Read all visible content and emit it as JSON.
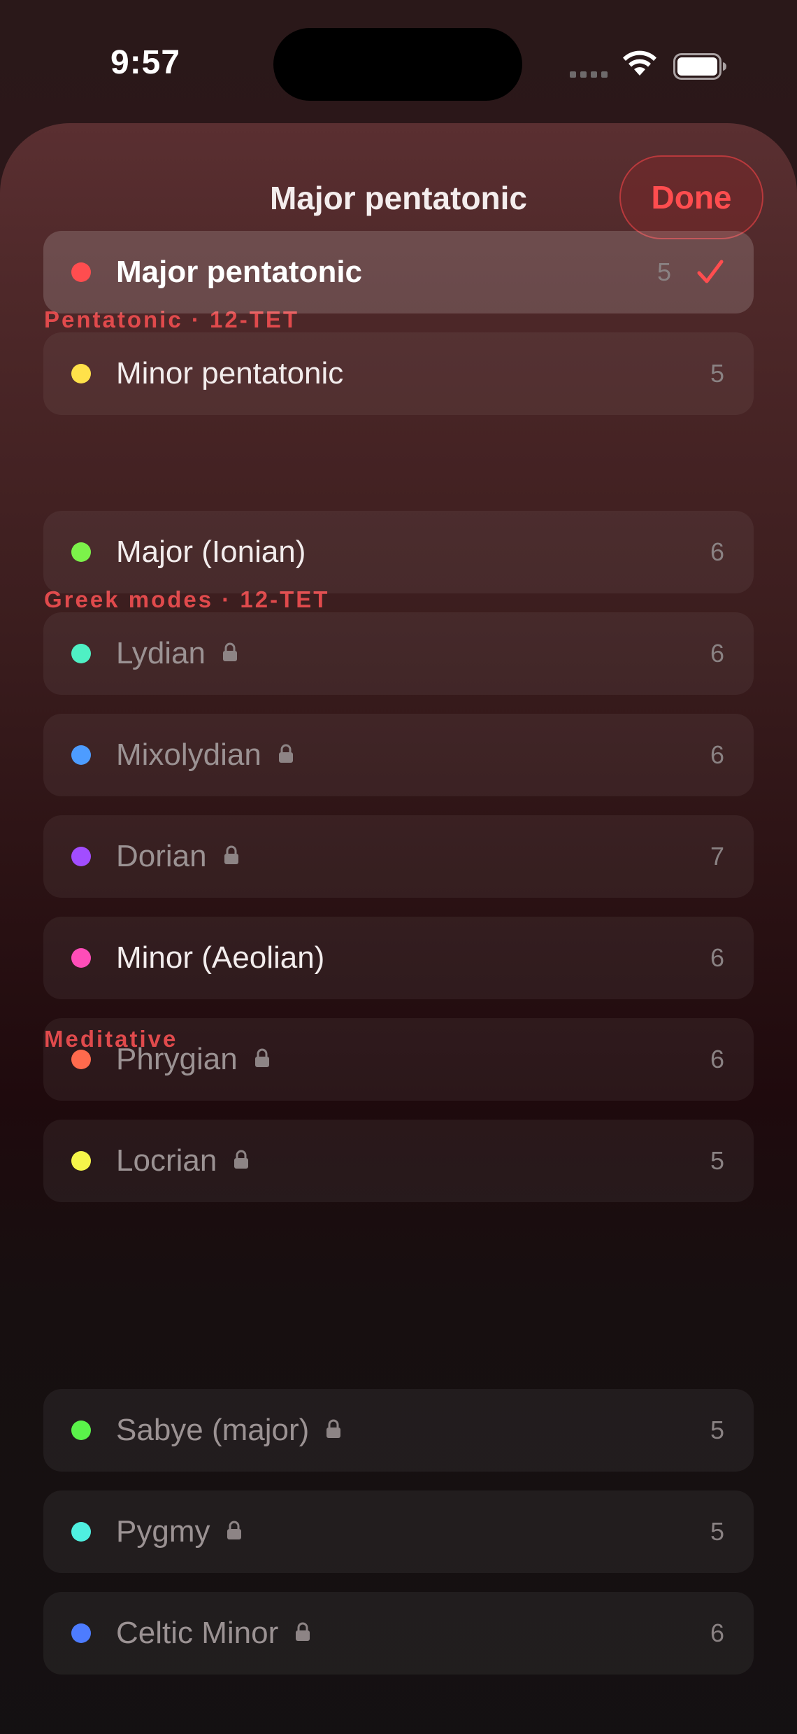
{
  "status_bar": {
    "time": "9:57"
  },
  "sheet": {
    "title": "Major pentatonic",
    "done_label": "Done"
  },
  "sections": [
    {
      "header": "Pentatonic · 12-TET",
      "items": [
        {
          "label": "Major pentatonic",
          "count": "5",
          "color": "#ff4d4f",
          "locked": false,
          "selected": true
        },
        {
          "label": "Minor pentatonic",
          "count": "5",
          "color": "#ffe14a",
          "locked": false,
          "selected": false
        }
      ]
    },
    {
      "header": "Greek modes · 12-TET",
      "items": [
        {
          "label": "Major (Ionian)",
          "count": "6",
          "color": "#7cf24a",
          "locked": false,
          "selected": false
        },
        {
          "label": "Lydian",
          "count": "6",
          "color": "#4ff0c4",
          "locked": true,
          "selected": false
        },
        {
          "label": "Mixolydian",
          "count": "6",
          "color": "#4d9cff",
          "locked": true,
          "selected": false
        },
        {
          "label": "Dorian",
          "count": "7",
          "color": "#a24dff",
          "locked": true,
          "selected": false
        },
        {
          "label": "Minor (Aeolian)",
          "count": "6",
          "color": "#ff4db8",
          "locked": false,
          "selected": false
        },
        {
          "label": "Phrygian",
          "count": "6",
          "color": "#ff6a4d",
          "locked": true,
          "selected": false
        },
        {
          "label": "Locrian",
          "count": "5",
          "color": "#f5f54a",
          "locked": true,
          "selected": false
        }
      ]
    },
    {
      "header": "Meditative",
      "items": [
        {
          "label": "Sabye (major)",
          "count": "5",
          "color": "#5af24a",
          "locked": true,
          "selected": false
        },
        {
          "label": "Pygmy",
          "count": "5",
          "color": "#4ff0e0",
          "locked": true,
          "selected": false
        },
        {
          "label": "Celtic Minor",
          "count": "6",
          "color": "#4d7cff",
          "locked": true,
          "selected": false
        }
      ]
    }
  ]
}
